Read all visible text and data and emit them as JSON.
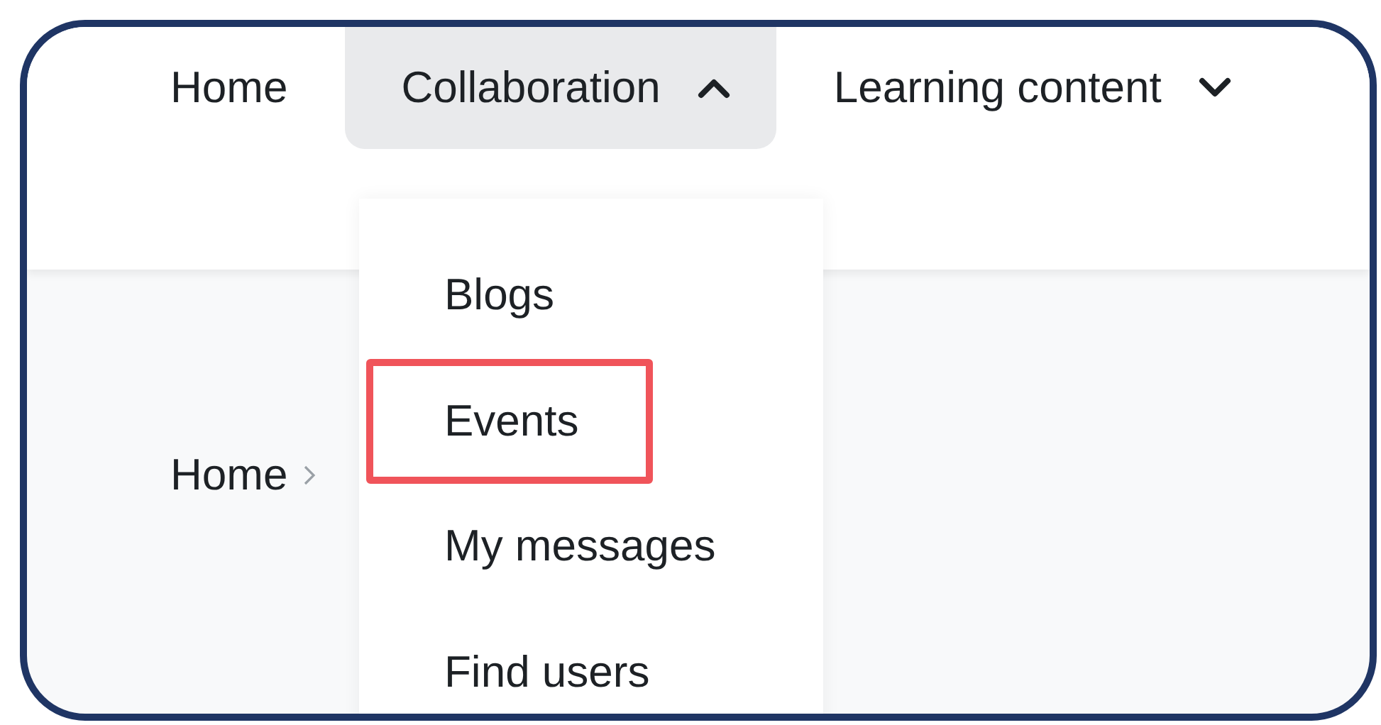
{
  "nav": [
    {
      "label": "Home",
      "kind": "link"
    },
    {
      "label": "Collaboration",
      "kind": "dropdown",
      "expanded": true
    },
    {
      "label": "Learning content",
      "kind": "dropdown",
      "expanded": false
    }
  ],
  "dropdown_menu": [
    {
      "label": "Blogs",
      "highlighted": false
    },
    {
      "label": "Events",
      "highlighted": true
    },
    {
      "label": "My messages",
      "highlighted": false
    },
    {
      "label": "Find users",
      "highlighted": false
    }
  ],
  "breadcrumb": [
    "Home"
  ]
}
